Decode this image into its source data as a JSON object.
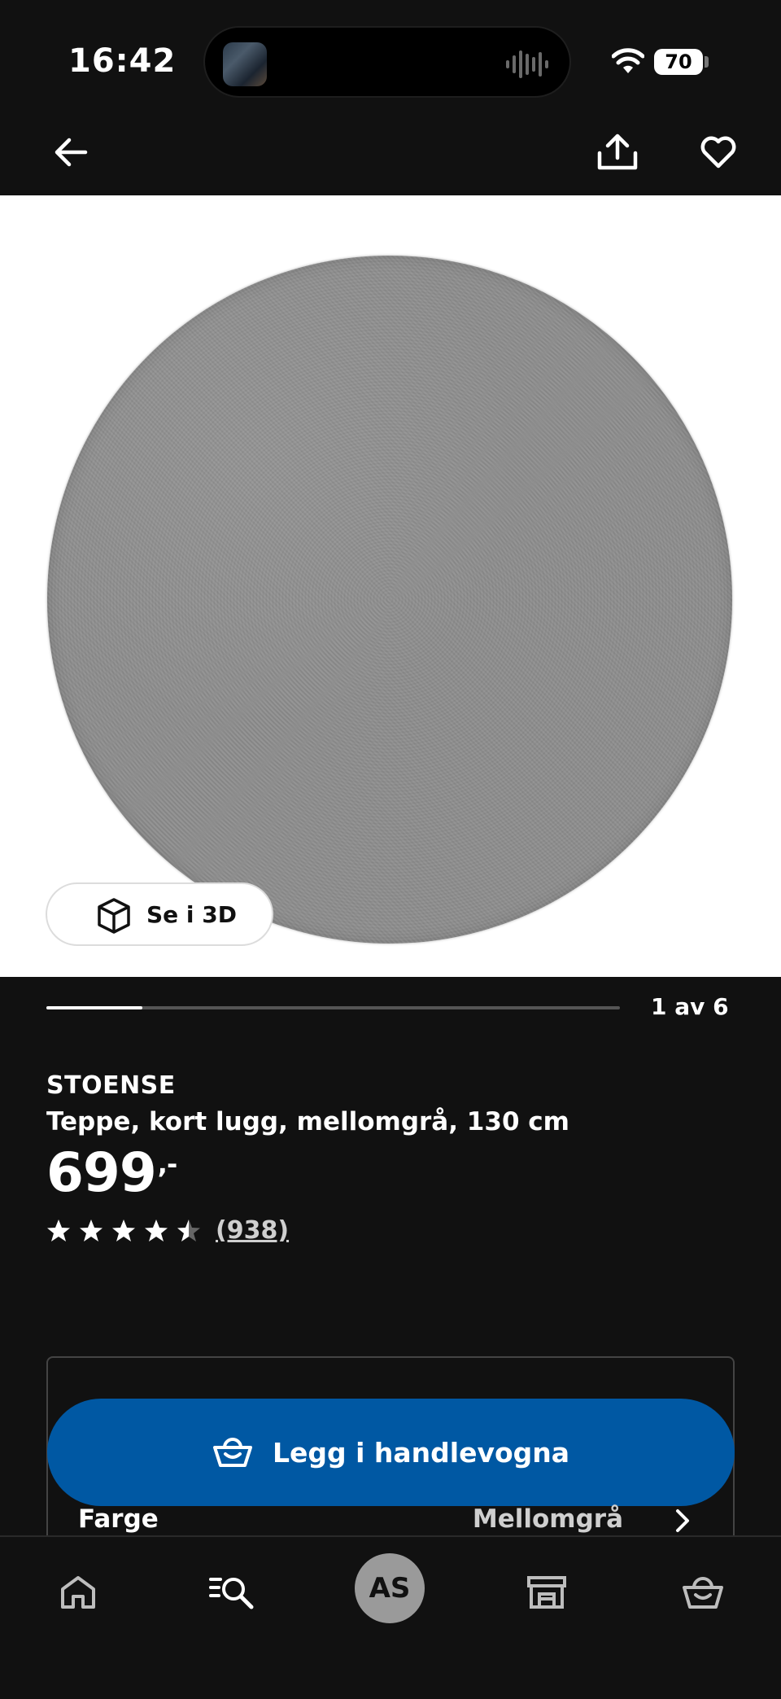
{
  "status_bar": {
    "time": "16:42",
    "battery": "70",
    "icons": [
      "now-playing-thumbnail",
      "audio-waveform-icon",
      "wifi-icon",
      "battery-icon"
    ]
  },
  "app_bar": {
    "icons": [
      "back-arrow-icon",
      "share-icon",
      "heart-icon"
    ]
  },
  "gallery": {
    "view_3d_label": "Se i 3D",
    "counter": "1 av 6",
    "current_index": 1,
    "total": 6
  },
  "product": {
    "brand": "STOENSE",
    "description": "Teppe, kort lugg, mellomgrå, 130 cm",
    "price": "699",
    "price_suffix": ",-",
    "rating": 4.5,
    "rating_max": 5,
    "reviews": "(938)"
  },
  "purchase": {
    "add_to_cart_label": "Legg i handlevogna",
    "color_label": "Farge",
    "color_value": "Mellomgrå"
  },
  "bottom_nav": {
    "items": [
      "home-icon",
      "search-icon",
      "profile-avatar",
      "store-icon",
      "cart-icon"
    ],
    "avatar_initials": "AS"
  },
  "colors": {
    "background": "#111111",
    "accent_blue": "#0058a3",
    "image_background": "#ffffff"
  }
}
